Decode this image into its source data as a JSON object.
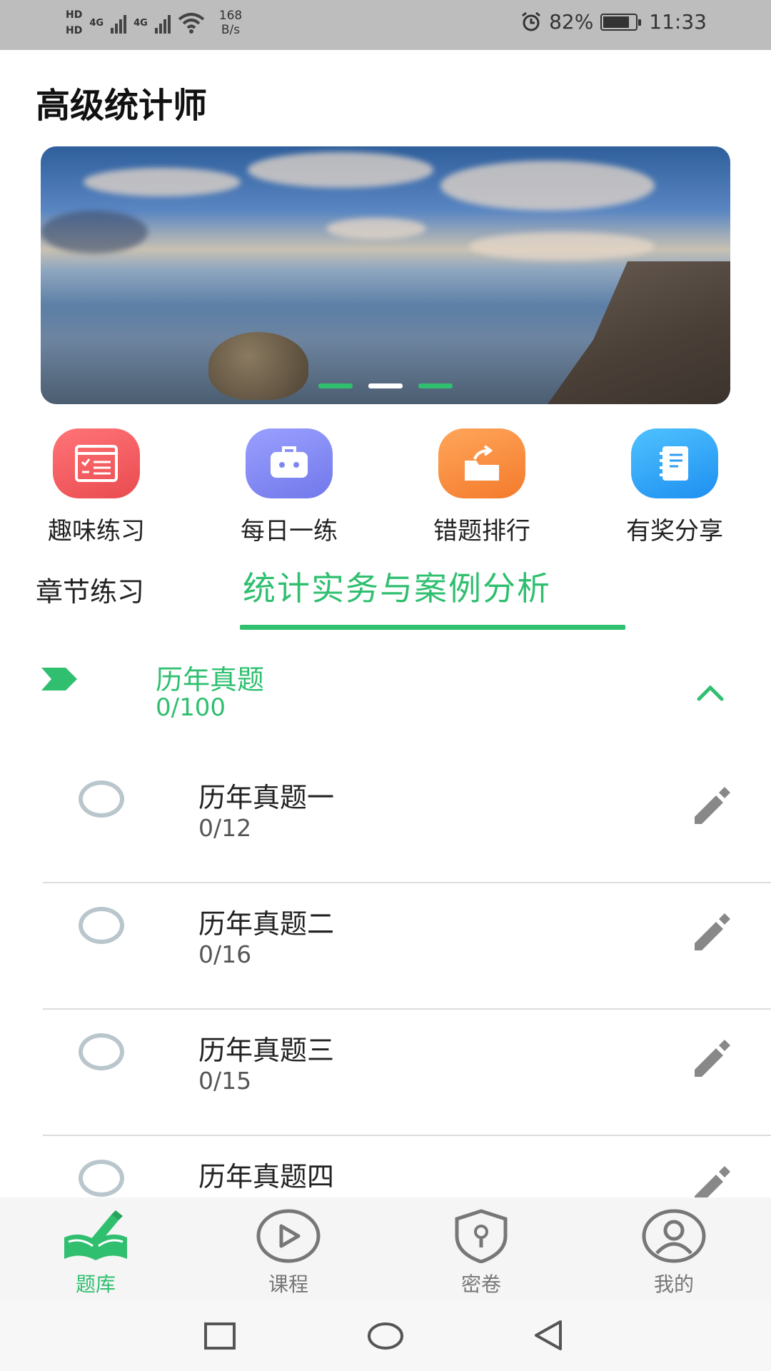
{
  "status_bar": {
    "hd1": "HD",
    "hd2": "HD",
    "net1": "4G",
    "net2": "4G",
    "speed_value": "168",
    "speed_unit": "B/s",
    "battery": "82%",
    "battery_level": 0.82,
    "time": "11:33"
  },
  "app": {
    "title": "高级统计师"
  },
  "banner": {
    "slide_count": 3,
    "active_index": 1
  },
  "quick_actions": [
    {
      "label": "趣味练习",
      "icon": "checklist-icon",
      "color": "#f0565a"
    },
    {
      "label": "每日一练",
      "icon": "robot-icon",
      "color": "#7f86f2"
    },
    {
      "label": "错题排行",
      "icon": "folder-export-icon",
      "color": "#fb8a3a"
    },
    {
      "label": "有奖分享",
      "icon": "notebook-icon",
      "color": "#2f9ef3"
    }
  ],
  "tabs": {
    "chapter": "章节练习",
    "active": "统计实务与案例分析"
  },
  "section": {
    "title": "历年真题",
    "count": "0/100"
  },
  "items": [
    {
      "title": "历年真题一",
      "count": "0/12"
    },
    {
      "title": "历年真题二",
      "count": "0/16"
    },
    {
      "title": "历年真题三",
      "count": "0/15"
    },
    {
      "title": "历年真题四",
      "count": ""
    }
  ],
  "bottom_nav": [
    {
      "label": "题库",
      "icon": "book-pencil-icon",
      "active": true
    },
    {
      "label": "课程",
      "icon": "play-circle-icon",
      "active": false
    },
    {
      "label": "密卷",
      "icon": "shield-lock-icon",
      "active": false
    },
    {
      "label": "我的",
      "icon": "user-icon",
      "active": false
    }
  ],
  "colors": {
    "accent": "#2fbf6f",
    "text": "#222222",
    "muted": "#888888"
  }
}
